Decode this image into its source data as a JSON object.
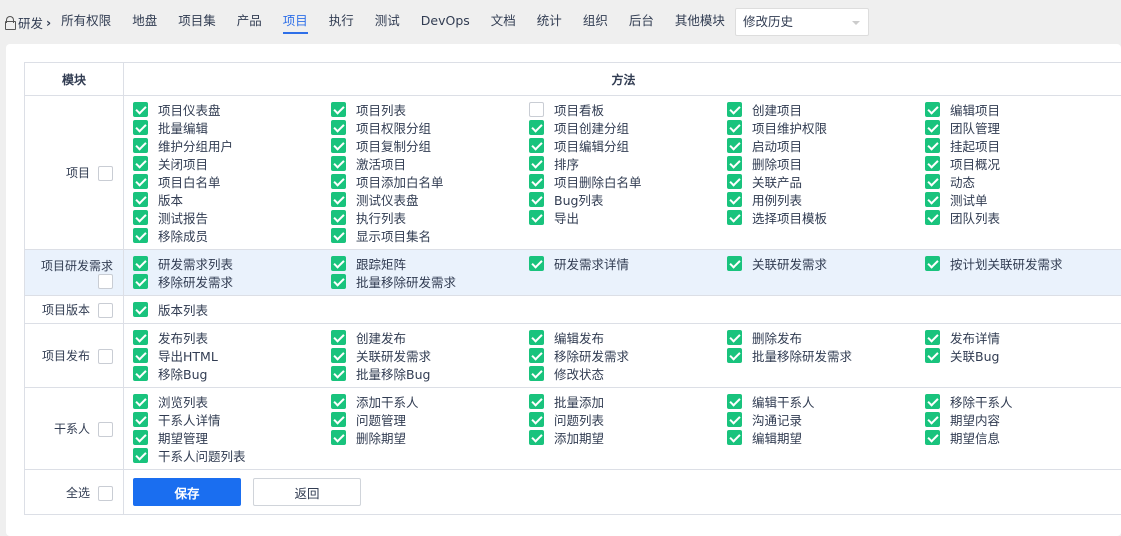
{
  "nav": {
    "root": "研发",
    "tabs": [
      "所有权限",
      "地盘",
      "项目集",
      "产品",
      "项目",
      "执行",
      "测试",
      "DevOps",
      "文档",
      "统计",
      "组织",
      "后台",
      "其他模块"
    ],
    "active": 4,
    "select_value": "修改历史"
  },
  "table": {
    "headers": {
      "module": "模块",
      "method": "方法"
    },
    "groups": [
      {
        "module": "项目",
        "checked": false,
        "highlight": false,
        "items": [
          [
            "项目仪表盘",
            true
          ],
          [
            "项目列表",
            true
          ],
          [
            "项目看板",
            false
          ],
          [
            "创建项目",
            true
          ],
          [
            "编辑项目",
            true
          ],
          [
            "批量编辑",
            true
          ],
          [
            "项目权限分组",
            true
          ],
          [
            "项目创建分组",
            true
          ],
          [
            "项目维护权限",
            true
          ],
          [
            "团队管理",
            true
          ],
          [
            "维护分组用户",
            true
          ],
          [
            "项目复制分组",
            true
          ],
          [
            "项目编辑分组",
            true
          ],
          [
            "启动项目",
            true
          ],
          [
            "挂起项目",
            true
          ],
          [
            "关闭项目",
            true
          ],
          [
            "激活项目",
            true
          ],
          [
            "排序",
            true
          ],
          [
            "删除项目",
            true
          ],
          [
            "项目概况",
            true
          ],
          [
            "项目白名单",
            true
          ],
          [
            "项目添加白名单",
            true
          ],
          [
            "项目删除白名单",
            true
          ],
          [
            "关联产品",
            true
          ],
          [
            "动态",
            true
          ],
          [
            "版本",
            true
          ],
          [
            "测试仪表盘",
            true
          ],
          [
            "Bug列表",
            true
          ],
          [
            "用例列表",
            true
          ],
          [
            "测试单",
            true
          ],
          [
            "测试报告",
            true
          ],
          [
            "执行列表",
            true
          ],
          [
            "导出",
            true
          ],
          [
            "选择项目模板",
            true
          ],
          [
            "团队列表",
            true
          ],
          [
            "移除成员",
            true
          ],
          [
            "显示项目集名",
            true
          ]
        ]
      },
      {
        "module": "项目研发需求",
        "checked": false,
        "highlight": true,
        "items": [
          [
            "研发需求列表",
            true
          ],
          [
            "跟踪矩阵",
            true
          ],
          [
            "研发需求详情",
            true
          ],
          [
            "关联研发需求",
            true
          ],
          [
            "按计划关联研发需求",
            true
          ],
          [
            "移除研发需求",
            true
          ],
          [
            "批量移除研发需求",
            true
          ]
        ]
      },
      {
        "module": "项目版本",
        "checked": false,
        "highlight": false,
        "items": [
          [
            "版本列表",
            true
          ]
        ]
      },
      {
        "module": "项目发布",
        "checked": false,
        "highlight": false,
        "items": [
          [
            "发布列表",
            true
          ],
          [
            "创建发布",
            true
          ],
          [
            "编辑发布",
            true
          ],
          [
            "删除发布",
            true
          ],
          [
            "发布详情",
            true
          ],
          [
            "导出HTML",
            true
          ],
          [
            "关联研发需求",
            true
          ],
          [
            "移除研发需求",
            true
          ],
          [
            "批量移除研发需求",
            true
          ],
          [
            "关联Bug",
            true
          ],
          [
            "移除Bug",
            true
          ],
          [
            "批量移除Bug",
            true
          ],
          [
            "修改状态",
            true
          ]
        ]
      },
      {
        "module": "干系人",
        "checked": false,
        "highlight": false,
        "items": [
          [
            "浏览列表",
            true
          ],
          [
            "添加干系人",
            true
          ],
          [
            "批量添加",
            true
          ],
          [
            "编辑干系人",
            true
          ],
          [
            "移除干系人",
            true
          ],
          [
            "干系人详情",
            true
          ],
          [
            "问题管理",
            true
          ],
          [
            "问题列表",
            true
          ],
          [
            "沟通记录",
            true
          ],
          [
            "期望内容",
            true
          ],
          [
            "期望管理",
            true
          ],
          [
            "删除期望",
            true
          ],
          [
            "添加期望",
            true
          ],
          [
            "编辑期望",
            true
          ],
          [
            "期望信息",
            true
          ],
          [
            "干系人问题列表",
            true
          ]
        ]
      }
    ],
    "select_all": "全选",
    "save": "保存",
    "back": "返回"
  },
  "colors": {
    "check": "#19c37d",
    "primary": "#1a6ef0",
    "active_tab": "#2e6fe8"
  }
}
